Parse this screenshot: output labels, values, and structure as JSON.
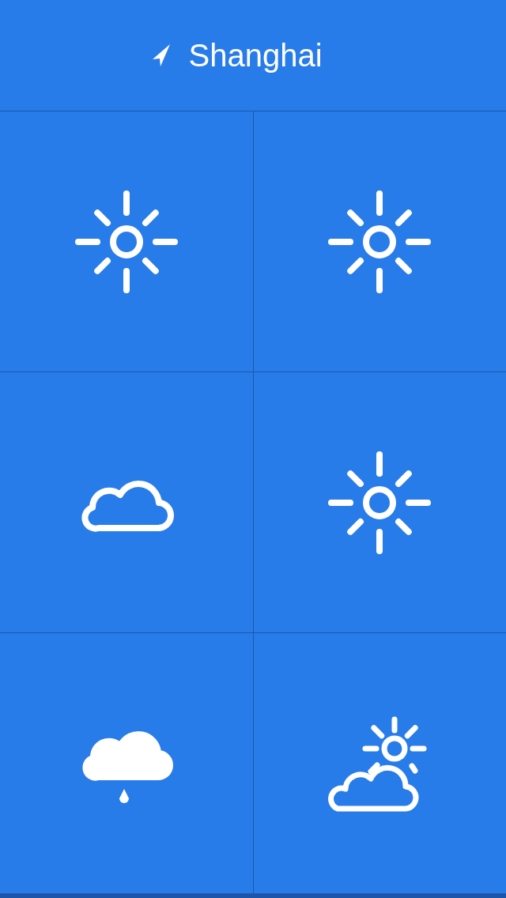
{
  "header": {
    "city": "Shanghai"
  },
  "tiles": [
    {
      "kind": "sun"
    },
    {
      "kind": "sun"
    },
    {
      "kind": "cloud"
    },
    {
      "kind": "sun"
    },
    {
      "kind": "rain"
    },
    {
      "kind": "partly-cloudy"
    }
  ]
}
